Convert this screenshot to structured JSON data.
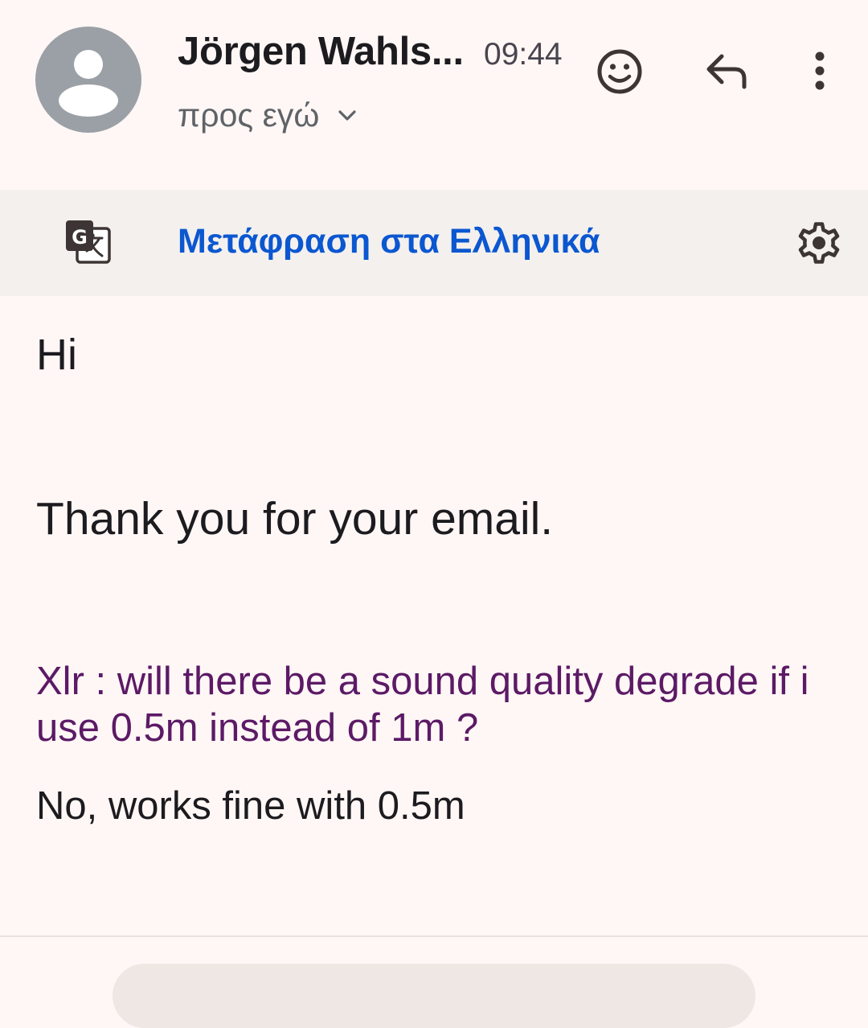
{
  "header": {
    "sender_name": "Jörgen Wahls...",
    "time": "09:44",
    "recipient": "προς εγώ"
  },
  "translate_bar": {
    "link_label": "Μετάφραση στα Ελληνικά"
  },
  "message": {
    "greeting": "Hi",
    "thanks": "Thank you for your email.",
    "quoted_question": "Xlr : will there be a sound quality degrade if i use 0.5m instead of 1m ?",
    "reply": "No, works fine with 0.5m"
  },
  "icons": {
    "avatar": "person-icon",
    "recipient_toggle": "chevron-down-icon",
    "emoji": "emoji-reaction-icon",
    "reply": "reply-icon",
    "more": "more-vert-icon",
    "translate": "google-translate-icon",
    "settings": "gear-icon"
  },
  "colors": {
    "background": "#fff7f5",
    "translate_bar": "#f3f0ee",
    "link": "#0b57d0",
    "quote": "#5c1a66",
    "avatar": "#9aa0a6"
  }
}
